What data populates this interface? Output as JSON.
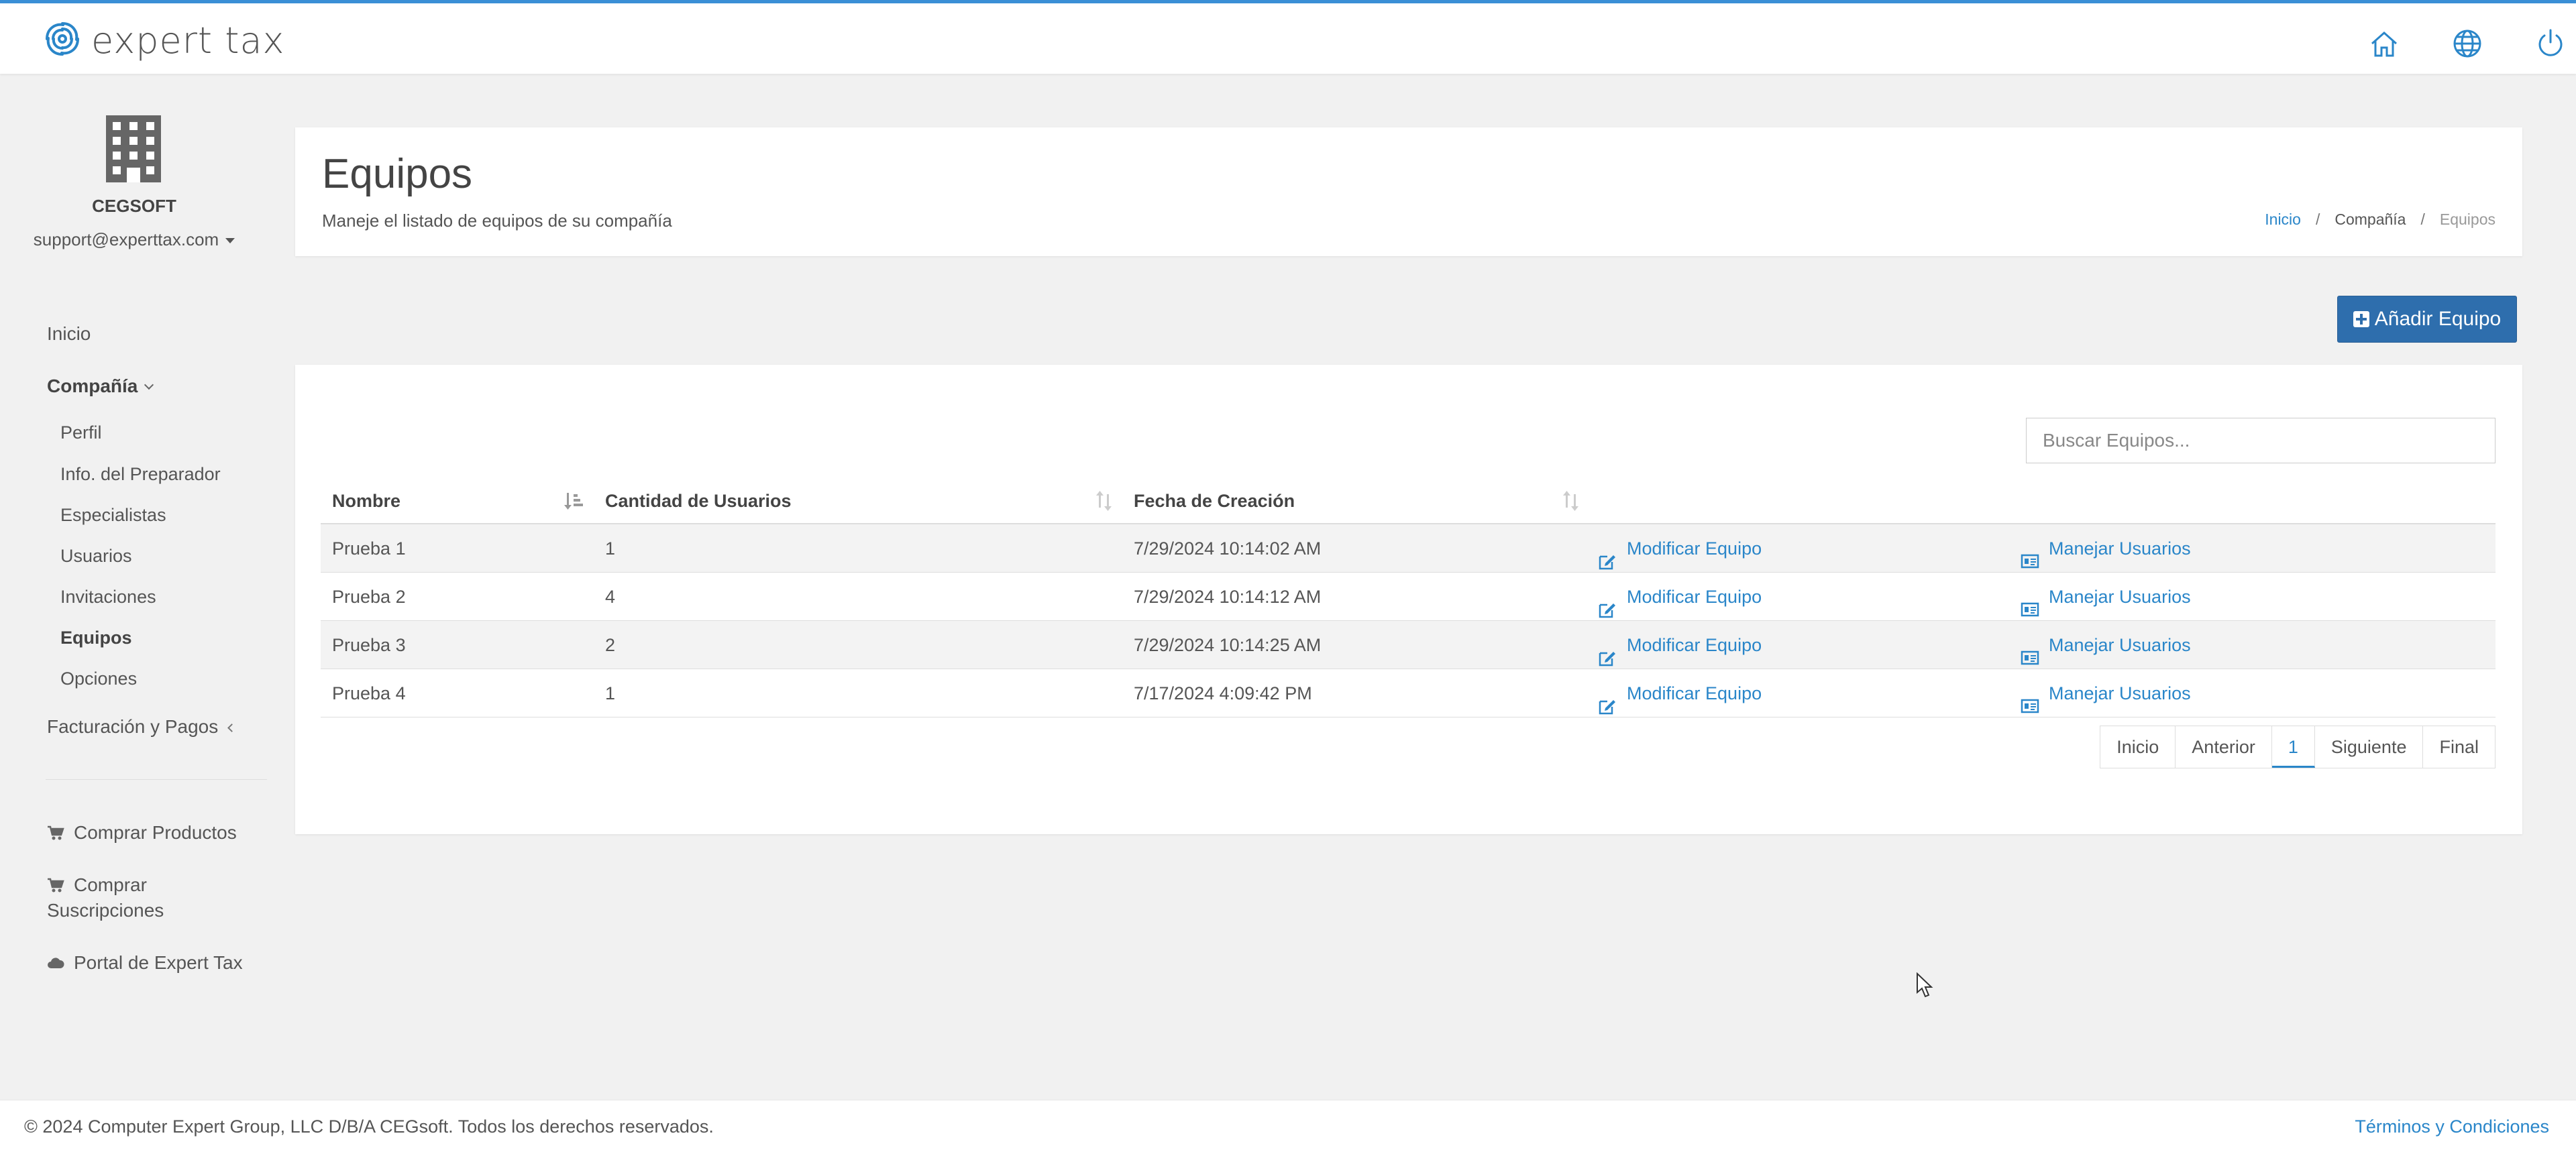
{
  "app": {
    "logo_text": "expert tax"
  },
  "topbar": {
    "icons": [
      "home-icon",
      "globe-icon",
      "power-icon"
    ]
  },
  "company": {
    "name": "CEGSOFT",
    "user_email": "support@experttax.com"
  },
  "sidebar": {
    "inicio": "Inicio",
    "compania": "Compañía",
    "sub_items": [
      "Perfil",
      "Info. del Preparador",
      "Especialistas",
      "Usuarios",
      "Invitaciones",
      "Equipos",
      "Opciones"
    ],
    "active_sub": "Equipos",
    "facturacion": "Facturación y Pagos",
    "comprar_productos": "Comprar Productos",
    "comprar_suscripciones_1": "Comprar",
    "comprar_suscripciones_2": "Suscripciones",
    "portal": "Portal de Expert Tax"
  },
  "header": {
    "title": "Equipos",
    "subtitle": "Maneje el listado de equipos de su compañía",
    "breadcrumb": [
      "Inicio",
      "Compañía",
      "Equipos"
    ]
  },
  "actions": {
    "add_team": "Añadir Equipo"
  },
  "search": {
    "placeholder": "Buscar Equipos..."
  },
  "table": {
    "columns": [
      "Nombre",
      "Cantidad de Usuarios",
      "Fecha de Creación"
    ],
    "rows": [
      {
        "name": "Prueba 1",
        "users": "1",
        "created": "7/29/2024 10:14:02 AM",
        "edit": "Modificar Equipo",
        "manage": "Manejar Usuarios"
      },
      {
        "name": "Prueba 2",
        "users": "4",
        "created": "7/29/2024 10:14:12 AM",
        "edit": "Modificar Equipo",
        "manage": "Manejar Usuarios"
      },
      {
        "name": "Prueba 3",
        "users": "2",
        "created": "7/29/2024 10:14:25 AM",
        "edit": "Modificar Equipo",
        "manage": "Manejar Usuarios"
      },
      {
        "name": "Prueba 4",
        "users": "1",
        "created": "7/17/2024 4:09:42 PM",
        "edit": "Modificar Equipo",
        "manage": "Manejar Usuarios"
      }
    ]
  },
  "pagination": {
    "first": "Inicio",
    "prev": "Anterior",
    "current": "1",
    "next": "Siguiente",
    "last": "Final"
  },
  "footer": {
    "copyright": "© 2024 Computer Expert Group, LLC D/B/A CEGsoft. Todos los derechos reservados.",
    "terms": "Términos y Condiciones"
  },
  "colors": {
    "accent": "#2a86c9",
    "primary_button": "#2e6ead"
  }
}
